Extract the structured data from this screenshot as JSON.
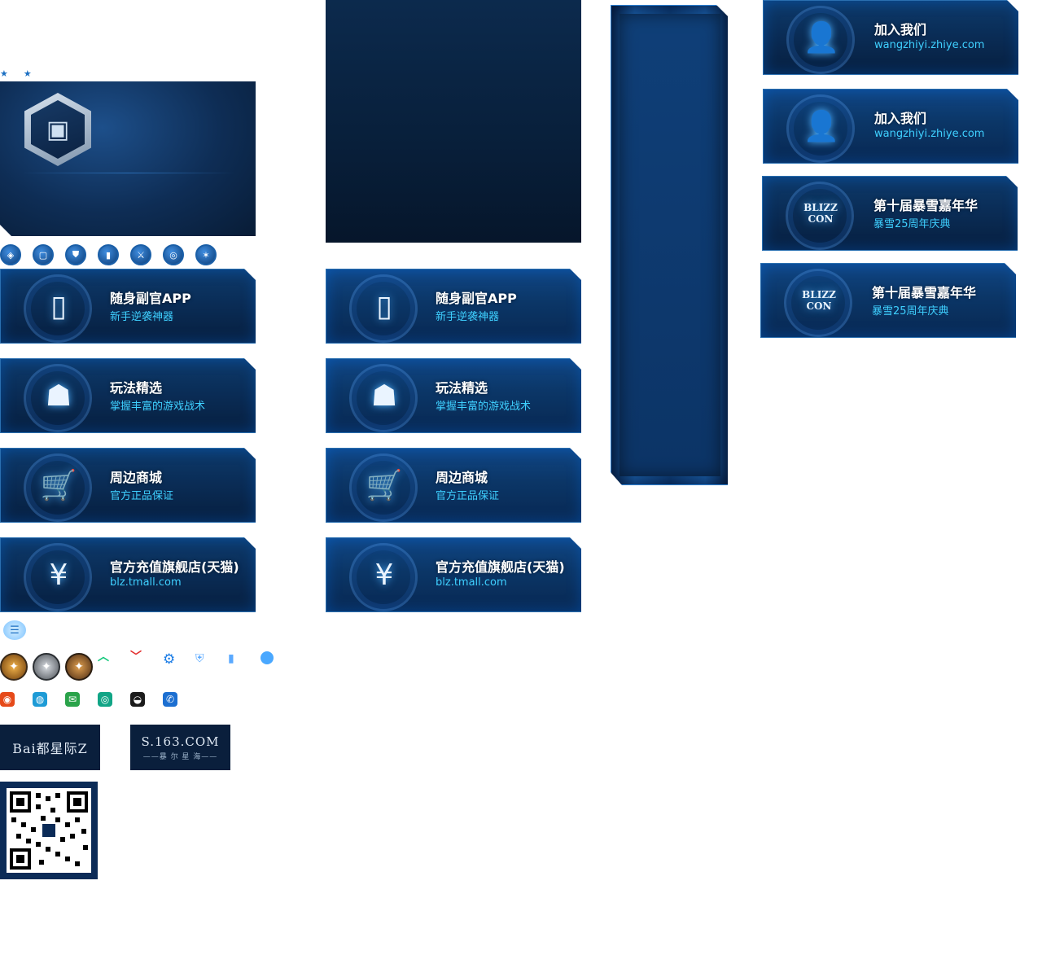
{
  "stars": "★ ★",
  "cards_left": [
    {
      "title": "随身副官APP",
      "sub": "新手逆袭神器",
      "icon": "phone-app-icon",
      "glyph": "▯"
    },
    {
      "title": "玩法精选",
      "sub": "掌握丰富的游戏战术",
      "icon": "robot-soldier-icon",
      "glyph": "☗"
    },
    {
      "title": "周边商城",
      "sub": "官方正品保证",
      "icon": "shopping-cart-icon",
      "glyph": "🛒"
    },
    {
      "title": "官方充值旗舰店(天猫)",
      "sub": "blz.tmall.com",
      "icon": "yen-recharge-icon",
      "glyph": "¥"
    }
  ],
  "cards_mid": [
    {
      "title": "随身副官APP",
      "sub": "新手逆袭神器",
      "icon": "phone-app-icon",
      "glyph": "▯"
    },
    {
      "title": "玩法精选",
      "sub": "掌握丰富的游戏战术",
      "icon": "robot-soldier-icon",
      "glyph": "☗"
    },
    {
      "title": "周边商城",
      "sub": "官方正品保证",
      "icon": "shopping-cart-icon",
      "glyph": "🛒"
    },
    {
      "title": "官方充值旗舰店(天猫)",
      "sub": "blz.tmall.com",
      "icon": "yen-recharge-icon",
      "glyph": "¥"
    }
  ],
  "cards_right": [
    {
      "title": "加入我们",
      "sub": "wangzhiyi.zhiye.com",
      "icon": "join-us-icon",
      "glyph": "👤"
    },
    {
      "title": "加入我们",
      "sub": "wangzhiyi.zhiye.com",
      "icon": "join-us-icon",
      "glyph": "👤"
    },
    {
      "title": "第十届暴雪嘉年华",
      "sub": "暴雪25周年庆典",
      "icon": "blizzcon-icon",
      "glyph": "BLIZZ CON"
    },
    {
      "title": "第十届暴雪嘉年华",
      "sub": "暴雪25周年庆典",
      "icon": "blizzcon-icon",
      "glyph": "BLIZZ CON"
    }
  ],
  "nav_icons": [
    "◈",
    "▢",
    "⛊",
    "▮",
    "⚔",
    "◎",
    "✶"
  ],
  "arrows": {
    "up": "︿",
    "down": "﹀"
  },
  "logos": {
    "baidu": "Bai都星际Z",
    "s163": "S.163.COM",
    "s163_sub": "——暴 尔 星 海——"
  },
  "colors": {
    "accent": "#3fd0ff",
    "card_dark": "#0a2d57",
    "border": "#2a6fb0"
  }
}
